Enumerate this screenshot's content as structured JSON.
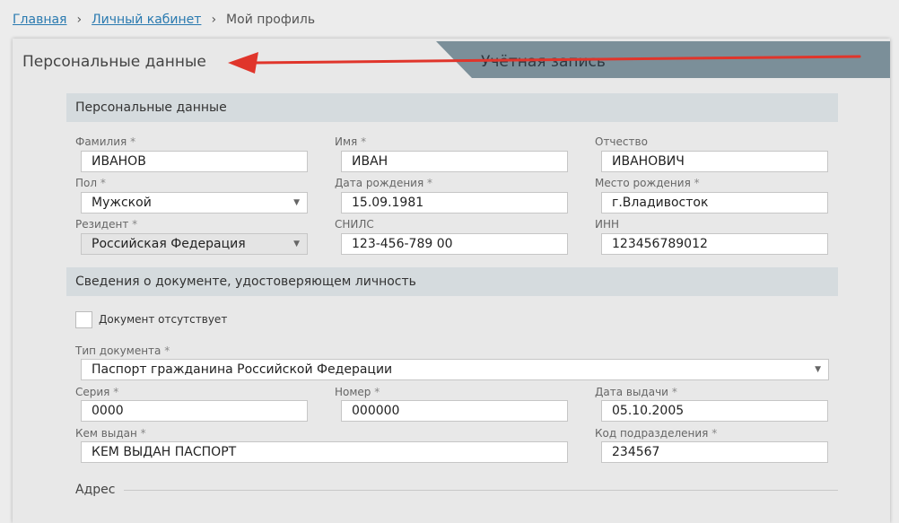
{
  "breadcrumb": {
    "home": "Главная",
    "cabinet": "Личный кабинет",
    "current": "Мой профиль",
    "separator": "›"
  },
  "tabs": {
    "personal": "Персональные данные",
    "account": "Учётная запись"
  },
  "sections": {
    "personal": "Персональные данные",
    "document": "Сведения о документе, удостоверяющем личность",
    "address": "Адрес"
  },
  "personal": {
    "last_name": {
      "label": "Фамилия",
      "value": "ИВАНОВ"
    },
    "first_name": {
      "label": "Имя",
      "value": "ИВАН"
    },
    "patronymic": {
      "label": "Отчество",
      "value": "ИВАНОВИЧ"
    },
    "gender": {
      "label": "Пол",
      "value": "Мужской"
    },
    "birth_date": {
      "label": "Дата рождения",
      "value": "15.09.1981"
    },
    "birth_place": {
      "label": "Место рождения",
      "value": "г.Владивосток"
    },
    "resident": {
      "label": "Резидент",
      "value": "Российская Федерация"
    },
    "snils": {
      "label": "СНИЛС",
      "value": "123-456-789 00"
    },
    "inn": {
      "label": "ИНН",
      "value": "123456789012"
    }
  },
  "document": {
    "absent_label": "Документ отсутствует",
    "type": {
      "label": "Тип документа",
      "value": "Паспорт гражданина Российской Федерации"
    },
    "series": {
      "label": "Серия",
      "value": "0000"
    },
    "number": {
      "label": "Номер",
      "value": "000000"
    },
    "issue_date": {
      "label": "Дата выдачи",
      "value": "05.10.2005"
    },
    "issued_by": {
      "label": "Кем выдан",
      "value": "КЕМ ВЫДАН ПАСПОРТ"
    },
    "division_code": {
      "label": "Код подразделения",
      "value": "234567"
    }
  },
  "required_mark": "*",
  "colors": {
    "link": "#2a7ab0",
    "section_header_bg": "#d5dbde",
    "account_tab_bg": "#7b8f99",
    "annotation_arrow": "#e0352b"
  }
}
